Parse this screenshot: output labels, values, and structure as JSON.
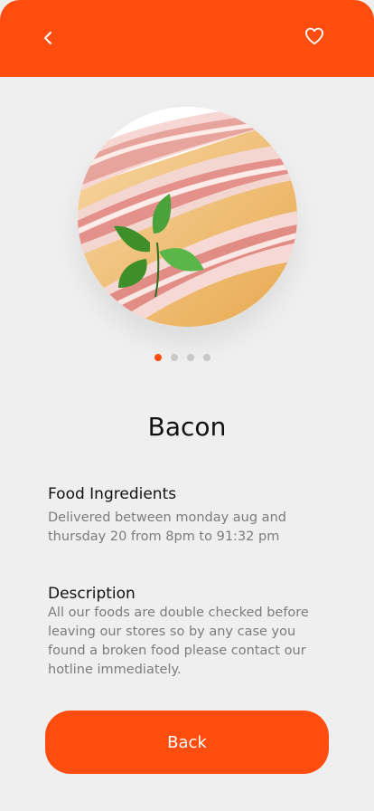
{
  "header": {
    "back_icon": "chevron-left-icon",
    "favorite_icon": "heart-outline-icon",
    "background_color": "#FF4D0F"
  },
  "product": {
    "title": "Bacon",
    "image_alt": "Bacon slices with basil leaves"
  },
  "carousel": {
    "page_count": 4,
    "active_index": 0,
    "active_color": "#FF4D0F",
    "inactive_color": "#C8C8C8"
  },
  "sections": {
    "ingredients": {
      "heading": "Food Ingredients",
      "text": "Delivered between monday aug and thursday 20 from 8pm to 91:32 pm"
    },
    "description": {
      "heading": "Description",
      "text": "All our foods are double checked before leaving our stores so by any case you found a broken food please contact our hotline immediately."
    }
  },
  "footer": {
    "back_button_label": "Back"
  }
}
